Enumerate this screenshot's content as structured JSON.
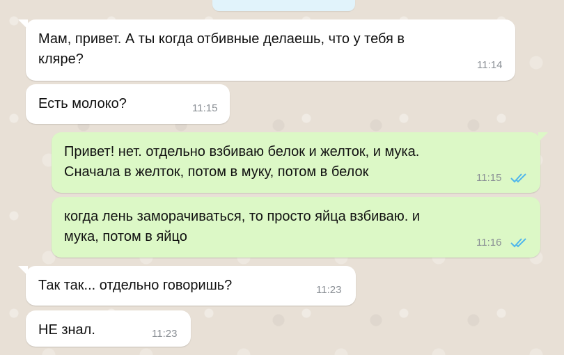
{
  "chat": {
    "messages": [
      {
        "direction": "incoming",
        "text": "Мам, привет. А ты когда отбивные делаешь, что у тебя в\nкляре?",
        "time": "11:14"
      },
      {
        "direction": "incoming",
        "text": "Есть молоко?",
        "time": "11:15"
      },
      {
        "direction": "outgoing",
        "text": "Привет! нет. отдельно взбиваю белок и желток, и мука.\nСначала в желток, потом в муку, потом в белок",
        "time": "11:15",
        "status": "read"
      },
      {
        "direction": "outgoing",
        "text": "когда лень заморачиваться, то просто яйца взбиваю.  и\nмука, потом в яйцо",
        "time": "11:16",
        "status": "read"
      },
      {
        "direction": "incoming",
        "text": "Так так... отдельно говоришь?",
        "time": "11:23"
      },
      {
        "direction": "incoming",
        "text": "НЕ знал.",
        "time": "11:23"
      }
    ]
  },
  "colors": {
    "incoming_bubble": "#ffffff",
    "outgoing_bubble": "#dcf8c6",
    "read_ticks": "#4fb6ec",
    "timestamp": "#8a8f95",
    "wallpaper": "#e8e0d6"
  },
  "icons": {
    "read_status": "double-check-icon"
  }
}
